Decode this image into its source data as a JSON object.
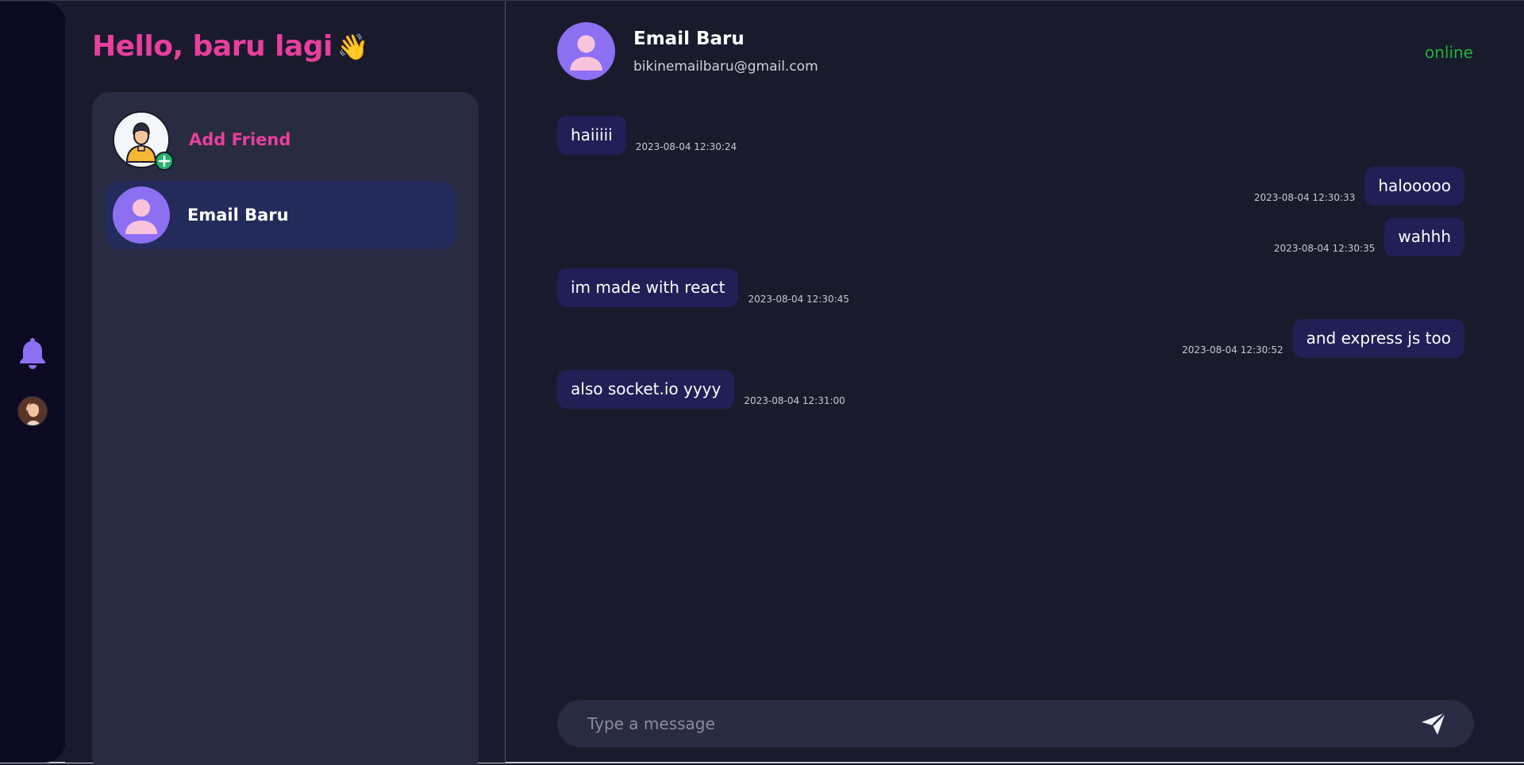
{
  "sidebar": {
    "greeting": "Hello, baru lagi",
    "greeting_emoji": "👋",
    "add_friend_label": "Add Friend",
    "contacts": [
      {
        "name": "Email Baru"
      }
    ]
  },
  "rail": {
    "icons": [
      "bell-icon",
      "user-avatar"
    ]
  },
  "chat": {
    "contact_name": "Email Baru",
    "contact_email": "bikinemailbaru@gmail.com",
    "status": "online",
    "messages": [
      {
        "text": "haiiiii",
        "time": "2023-08-04 12:30:24",
        "side": "left"
      },
      {
        "text": "halooooo",
        "time": "2023-08-04 12:30:33",
        "side": "right"
      },
      {
        "text": "wahhh",
        "time": "2023-08-04 12:30:35",
        "side": "right"
      },
      {
        "text": "im made with react",
        "time": "2023-08-04 12:30:45",
        "side": "left"
      },
      {
        "text": "and express js too",
        "time": "2023-08-04 12:30:52",
        "side": "right"
      },
      {
        "text": "also socket.io yyyy",
        "time": "2023-08-04 12:31:00",
        "side": "left"
      }
    ],
    "composer_placeholder": "Type a message"
  },
  "colors": {
    "accent_pink": "#e83f9c",
    "accent_purple": "#8d6ff2",
    "status_green": "#1db43a",
    "bubble": "#201f56"
  }
}
